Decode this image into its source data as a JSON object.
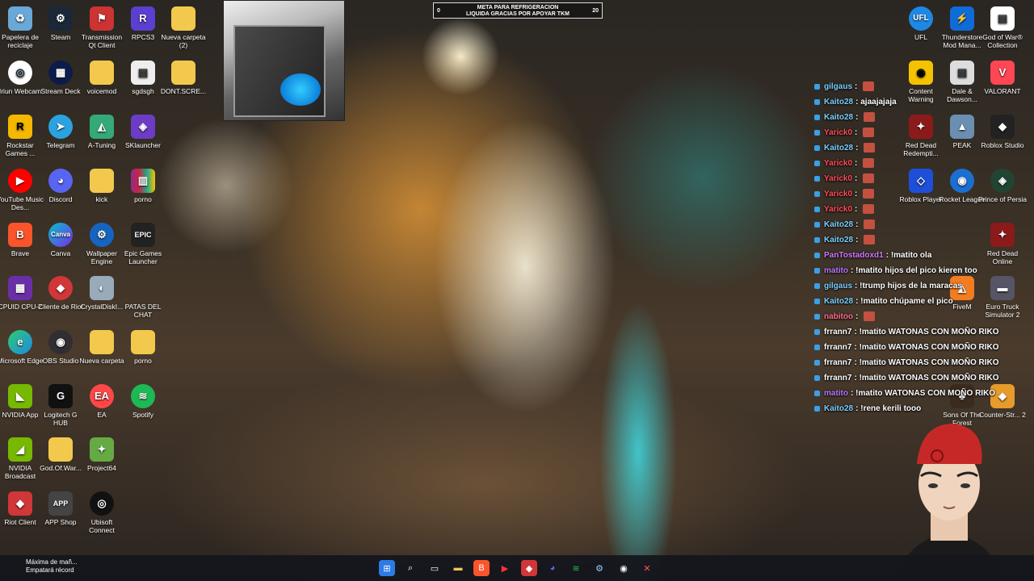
{
  "stream_overlay": {
    "goal": {
      "title_line1": "META PARA REFRIGERACION",
      "title_line2": "LIQUIDA GRACIAS POR APOYAR TKM",
      "min": "0",
      "max": "20"
    }
  },
  "desktop_icons": {
    "col1": [
      "Papelera de reciclaje",
      "Iriun Webcam",
      "Rockstar Games ...",
      "YouTube Music Des...",
      "Brave",
      "CPUID CPU-Z",
      "Microsoft Edge",
      "NVIDIA App",
      "NVIDIA Broadcast",
      "Riot Client"
    ],
    "col2": [
      "Steam",
      "Stream Deck",
      "Telegram",
      "Discord",
      "Canva",
      "Cliente de Riot",
      "OBS Studio",
      "Logitech G HUB",
      "God.Of.War...",
      "APP Shop"
    ],
    "col3": [
      "Transmission Qt Client",
      "voicemod",
      "A-Tuning",
      "kick",
      "Wallpaper Engine",
      "CrystalDiskI...",
      "Nueva carpeta",
      "EA",
      "Project64",
      "Ubisoft Connect"
    ],
    "col4": [
      "RPCS3",
      "sgdsgh",
      "SKlauncher",
      "porno",
      "Epic Games Launcher",
      "PATAS DEL CHAT",
      "porno",
      "Spotify"
    ],
    "col5": [
      "Nueva carpeta (2)",
      "DONT.SCRE..."
    ],
    "right_col1": [
      "UFL",
      "Content Warning",
      "Red Dead Redempti...",
      "Roblox Player"
    ],
    "right_col2": [
      "Thunderstore Mod Mana...",
      "Dale & Dawson...",
      "PEAK",
      "Rocket League",
      "FiveM",
      "Sons Of The Forest"
    ],
    "right_col3": [
      "God of War® Collection",
      "VALORANT",
      "Roblox Studio",
      "Prince of Persia",
      "Red Dead Online",
      "Euro Truck Simulator 2",
      "Counter-Str... 2"
    ]
  },
  "chat": [
    {
      "name": "gilgaus",
      "text": "",
      "color": "#7bd0ff"
    },
    {
      "name": "Kaito28",
      "text": "ajaajajaja",
      "color": "#7bd0ff"
    },
    {
      "name": "Kaito28",
      "text": "",
      "color": "#7bd0ff"
    },
    {
      "name": "Yarick0",
      "text": "",
      "color": "#ff4d5a"
    },
    {
      "name": "Kaito28",
      "text": "",
      "color": "#7bd0ff"
    },
    {
      "name": "Yarick0",
      "text": "",
      "color": "#ff4d5a"
    },
    {
      "name": "Yarick0",
      "text": "",
      "color": "#ff4d5a"
    },
    {
      "name": "Yarick0",
      "text": "",
      "color": "#ff4d5a"
    },
    {
      "name": "Yarick0",
      "text": "",
      "color": "#ff4d5a"
    },
    {
      "name": "Kaito28",
      "text": "",
      "color": "#7bd0ff"
    },
    {
      "name": "Kaito28",
      "text": "",
      "color": "#7bd0ff"
    },
    {
      "name": "PanTostadoxd1",
      "text": "!matito ola",
      "color": "#d37bff"
    },
    {
      "name": "matito",
      "text": "!matito hijos del pico kieren too",
      "color": "#b97bff"
    },
    {
      "name": "gilgaus",
      "text": "!trump hijos de la maracas",
      "color": "#7bd0ff"
    },
    {
      "name": "Kaito28",
      "text": "!matito chúpame el pico",
      "color": "#7bd0ff"
    },
    {
      "name": "nabitoo",
      "text": "",
      "color": "#ff6f8f"
    },
    {
      "name": "frrann7",
      "text": "!matito WATONAS CON MOÑO RIKO",
      "color": "#ffffff"
    },
    {
      "name": "frrann7",
      "text": "!matito WATONAS CON MOÑO RIKO",
      "color": "#ffffff"
    },
    {
      "name": "frrann7",
      "text": "!matito WATONAS CON MOÑO RIKO",
      "color": "#ffffff"
    },
    {
      "name": "frrann7",
      "text": "!matito WATONAS CON MOÑO RIKO",
      "color": "#ffffff"
    },
    {
      "name": "matito",
      "text": "!matito WATONAS CON MOÑO RIKO",
      "color": "#b97bff"
    },
    {
      "name": "Kaito28",
      "text": "!rene kerili tooo",
      "color": "#7bd0ff"
    }
  ],
  "taskbar": {
    "widget_line1": "Máxima de mañ...",
    "widget_line2": "Empatará récord"
  }
}
